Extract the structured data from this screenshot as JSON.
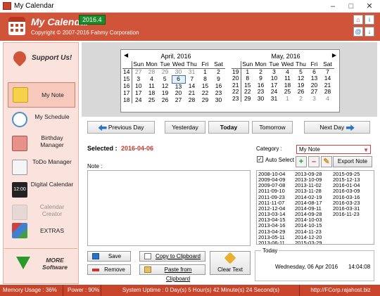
{
  "window": {
    "title": "My Calendar"
  },
  "header": {
    "app_name": "My Calendar",
    "version": "2016.4",
    "copyright": "Copyright © 2007-2016 Fahmy Corporation"
  },
  "sidebar": {
    "support": "Support Us!",
    "items": [
      {
        "label": "My Note",
        "icon": "note-icon",
        "active": true
      },
      {
        "label": "My Schedule",
        "icon": "schedule-clock-icon"
      },
      {
        "label": "Birthday Manager",
        "icon": "birthday-cake-icon"
      },
      {
        "label": "ToDo Manager",
        "icon": "todo-list-icon"
      },
      {
        "label": "Digital Calendar",
        "icon": "digital-clock-icon"
      },
      {
        "label": "Calendar Creator",
        "icon": "calendar-creator-icon",
        "disabled": true
      },
      {
        "label": "EXTRAS",
        "icon": "extras-cubes-icon"
      }
    ],
    "more_software": "MORE Software"
  },
  "calendar": {
    "weekdays": [
      "Sun",
      "Mon",
      "Tue",
      "Wed",
      "Thu",
      "Fri",
      "Sat"
    ],
    "months": [
      {
        "title": "April, 2016",
        "weeks": [
          "14",
          "15",
          "16",
          "17",
          "18"
        ],
        "rows": [
          [
            "27",
            "28",
            "29",
            "30",
            "31",
            "1",
            "2"
          ],
          [
            "3",
            "4",
            "5",
            "6",
            "7",
            "8",
            "9"
          ],
          [
            "10",
            "11",
            "12",
            "13",
            "14",
            "15",
            "16"
          ],
          [
            "17",
            "18",
            "19",
            "20",
            "21",
            "22",
            "23"
          ],
          [
            "24",
            "25",
            "26",
            "27",
            "28",
            "29",
            "30"
          ]
        ]
      },
      {
        "title": "May, 2016",
        "weeks": [
          "19",
          "20",
          "21",
          "22",
          "23"
        ],
        "rows": [
          [
            "1",
            "2",
            "3",
            "4",
            "5",
            "6",
            "7"
          ],
          [
            "8",
            "9",
            "10",
            "11",
            "12",
            "13",
            "14"
          ],
          [
            "15",
            "16",
            "17",
            "18",
            "19",
            "20",
            "21"
          ],
          [
            "22",
            "23",
            "24",
            "25",
            "26",
            "27",
            "28"
          ],
          [
            "29",
            "30",
            "31",
            "1",
            "2",
            "3",
            "4"
          ]
        ]
      }
    ]
  },
  "nav": {
    "previous_day": "Previous Day",
    "yesterday": "Yesterday",
    "today": "Today",
    "tomorrow": "Tomorrow",
    "next_day": "Next Day"
  },
  "note": {
    "selected_label": "Selected :",
    "selected_value": "2016-04-06",
    "note_label": "Note :",
    "category_label": "Category :",
    "category_value": "My Note",
    "auto_select": "Auto Select",
    "auto_select_checked": true,
    "export": "Export Note",
    "dates_col1": [
      "2008-10-04",
      "2009-04-09",
      "2009-07-08",
      "2011-09-10",
      "2011-09-23",
      "2011-11-07",
      "2012-12-04",
      "2013-03-14",
      "2013-04-15",
      "2013-04-16",
      "2013-04-29",
      "2013-05-11",
      "2013-06-11"
    ],
    "dates_col2": [
      "2013-09-28",
      "2013-10-09",
      "2013-11-02",
      "2013-11-28",
      "2014-02-19",
      "2014-08-17",
      "2014-09-11",
      "2014-09-28",
      "2014-10-03",
      "2014-10-15",
      "2014-11-23",
      "2014-12-20",
      "2015-03-29"
    ],
    "dates_col3": [
      "2015-09-25",
      "2015-12-13",
      "2016-01-04",
      "2016-03-09",
      "2016-03-16",
      "2016-03-23",
      "2016-03-31",
      "2016-11-23"
    ]
  },
  "actions": {
    "save": "Save",
    "copy": "Copy to Clipboard",
    "clear": "Clear Text",
    "remove": "Remove",
    "paste": "Paste from Clipboard"
  },
  "today_box": {
    "label": "Today",
    "date": "Wednesday, 06 Apr 2016",
    "time": "14:04:08"
  },
  "status": {
    "memory": "Memory Usage : 36%",
    "power": "Power : 90%",
    "uptime": "System Uptime : 0 Day(s) 5 Hour(s) 42 Minute(s) 24 Second(s)",
    "url": "http://FCorp.rajahost.biz"
  },
  "colors": {
    "accent": "#c8442b",
    "selected_date": "#c0392b",
    "sidebar_bg": "#fbe3dd"
  }
}
